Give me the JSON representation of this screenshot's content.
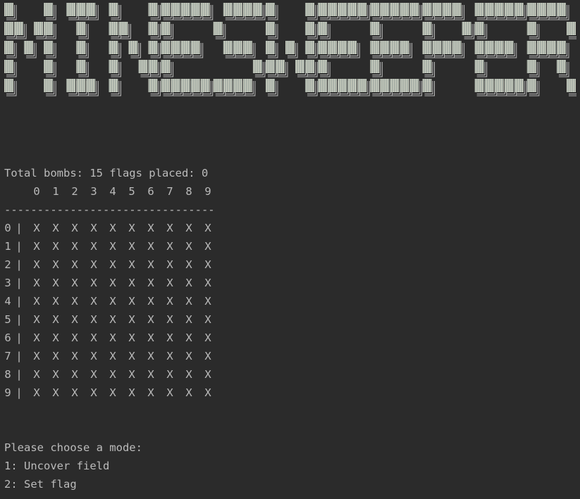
{
  "banner": {
    "text": "MINESWEEPER",
    "colors": {
      "block_fill": "#a9b1a8",
      "stripe": "#c9cdbf",
      "outline": "#bbbbbb"
    }
  },
  "status_line": "Total bombs: 15 flags placed: 0",
  "board": {
    "column_header": [
      "0",
      "1",
      "2",
      "3",
      "4",
      "5",
      "6",
      "7",
      "8",
      "9"
    ],
    "separator": "--------------------------------",
    "row_separator": "|",
    "rows": [
      {
        "label": "0",
        "cells": [
          "X",
          "X",
          "X",
          "X",
          "X",
          "X",
          "X",
          "X",
          "X",
          "X"
        ]
      },
      {
        "label": "1",
        "cells": [
          "X",
          "X",
          "X",
          "X",
          "X",
          "X",
          "X",
          "X",
          "X",
          "X"
        ]
      },
      {
        "label": "2",
        "cells": [
          "X",
          "X",
          "X",
          "X",
          "X",
          "X",
          "X",
          "X",
          "X",
          "X"
        ]
      },
      {
        "label": "3",
        "cells": [
          "X",
          "X",
          "X",
          "X",
          "X",
          "X",
          "X",
          "X",
          "X",
          "X"
        ]
      },
      {
        "label": "4",
        "cells": [
          "X",
          "X",
          "X",
          "X",
          "X",
          "X",
          "X",
          "X",
          "X",
          "X"
        ]
      },
      {
        "label": "5",
        "cells": [
          "X",
          "X",
          "X",
          "X",
          "X",
          "X",
          "X",
          "X",
          "X",
          "X"
        ]
      },
      {
        "label": "6",
        "cells": [
          "X",
          "X",
          "X",
          "X",
          "X",
          "X",
          "X",
          "X",
          "X",
          "X"
        ]
      },
      {
        "label": "7",
        "cells": [
          "X",
          "X",
          "X",
          "X",
          "X",
          "X",
          "X",
          "X",
          "X",
          "X"
        ]
      },
      {
        "label": "8",
        "cells": [
          "X",
          "X",
          "X",
          "X",
          "X",
          "X",
          "X",
          "X",
          "X",
          "X"
        ]
      },
      {
        "label": "9",
        "cells": [
          "X",
          "X",
          "X",
          "X",
          "X",
          "X",
          "X",
          "X",
          "X",
          "X"
        ]
      }
    ]
  },
  "prompt": {
    "question": "Please choose a mode:",
    "options": [
      "1: Uncover field",
      "2: Set flag"
    ]
  },
  "colors": {
    "background": "#2b2b2b",
    "text": "#bbbbbb"
  }
}
